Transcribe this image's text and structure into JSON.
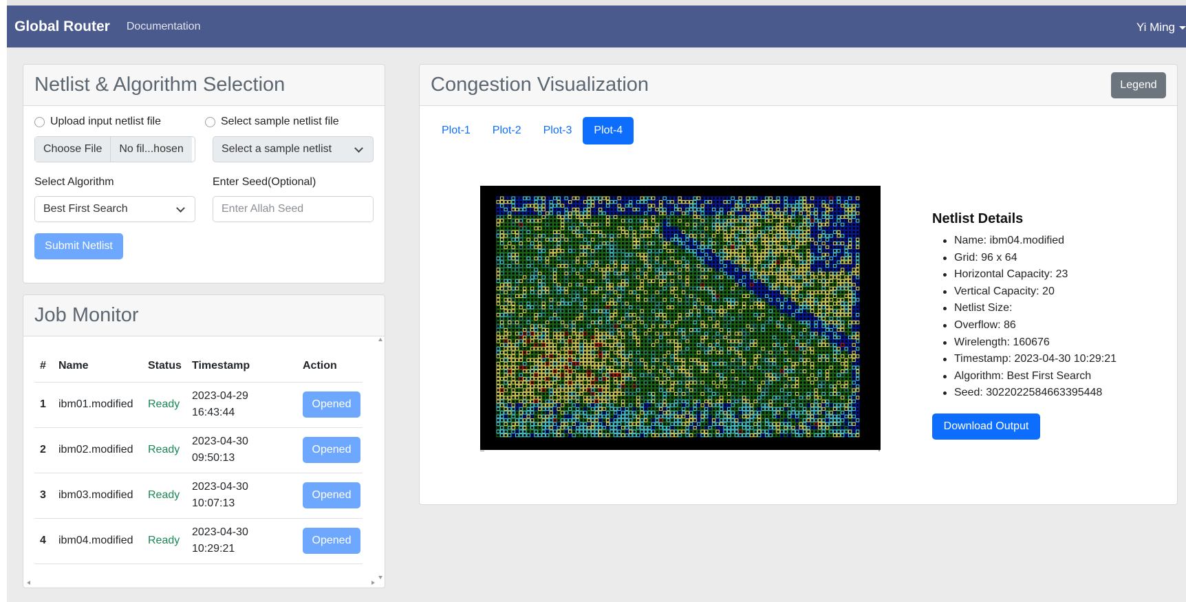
{
  "navbar": {
    "brand": "Global Router",
    "documentation": "Documentation",
    "user": "Yi Ming"
  },
  "netlist_card": {
    "title": "Netlist & Algorithm Selection",
    "upload_label": "Upload input netlist file",
    "sample_label": "Select sample netlist file",
    "choose_file": "Choose File",
    "file_name": "No fil...hosen",
    "sample_select": "Select a sample netlist",
    "algorithm_label": "Select Algorithm",
    "algorithm_value": "Best First Search",
    "seed_label": "Enter Seed(Optional)",
    "seed_placeholder": "Enter Allah Seed",
    "submit": "Submit Netlist"
  },
  "job_monitor": {
    "title": "Job Monitor",
    "columns": [
      "#",
      "Name",
      "Status",
      "Timestamp",
      "Action"
    ],
    "rows": [
      {
        "num": "1",
        "name": "ibm01.modified",
        "status": "Ready",
        "date": "2023-04-29",
        "time": "16:43:44",
        "action": "Opened"
      },
      {
        "num": "2",
        "name": "ibm02.modified",
        "status": "Ready",
        "date": "2023-04-30",
        "time": "09:50:13",
        "action": "Opened"
      },
      {
        "num": "3",
        "name": "ibm03.modified",
        "status": "Ready",
        "date": "2023-04-30",
        "time": "10:07:13",
        "action": "Opened"
      },
      {
        "num": "4",
        "name": "ibm04.modified",
        "status": "Ready",
        "date": "2023-04-30",
        "time": "10:29:21",
        "action": "Opened"
      }
    ]
  },
  "visualization": {
    "title": "Congestion Visualization",
    "legend": "Legend",
    "tabs": [
      "Plot-1",
      "Plot-2",
      "Plot-3",
      "Plot-4"
    ],
    "active_tab": "Plot-4",
    "details_title": "Netlist Details",
    "details": [
      "Name: ibm04.modified",
      "Grid: 96 x 64",
      "Horizontal Capacity: 23",
      "Vertical Capacity: 20",
      "Netlist Size:",
      "Overflow: 86",
      "Wirelength: 160676",
      "Timestamp: 2023-04-30 10:29:21",
      "Algorithm: Best First Search",
      "Seed: 3022022584663395448"
    ],
    "download": "Download Output",
    "heatmap": {
      "grid_cols": 96,
      "grid_rows": 64,
      "colors": {
        "low": "#0a1aa0",
        "cyan": "#49c8d2",
        "teal": "#2e8a78",
        "green": "#1e6e18",
        "yellow": "#d8d45a",
        "red": "#b41818"
      }
    }
  }
}
